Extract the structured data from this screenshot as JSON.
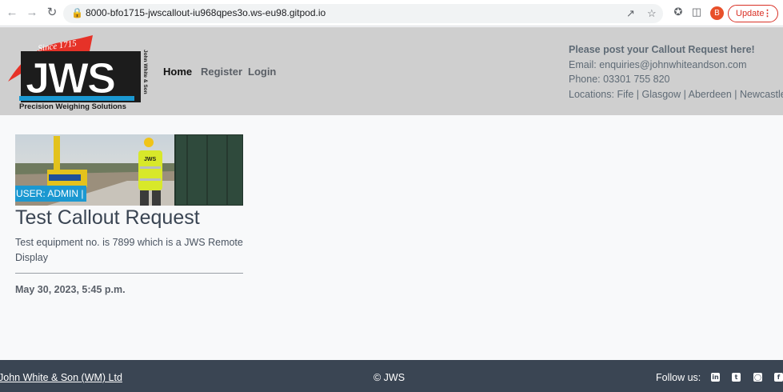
{
  "browser": {
    "url": "8000-bfo1715-jwscallout-iu968qpes3o.ws-eu98.gitpod.io",
    "profile_initial": "B",
    "update_label": "Update",
    "icons": [
      "back-arrow-icon",
      "forward-arrow-icon",
      "reload-icon",
      "lock-icon",
      "share-icon",
      "star-icon",
      "extensions-icon",
      "side-panel-icon",
      "kebab-menu-icon"
    ]
  },
  "header": {
    "logo": {
      "banner": "Since 1715",
      "brand": "JWS",
      "side_text": "John White & Son",
      "tagline": "Precision Weighing Solutions"
    },
    "nav": [
      {
        "label": "Home"
      },
      {
        "label": "Register"
      },
      {
        "label": "Login"
      }
    ],
    "contact": {
      "cta": "Please post your Callout Request here!",
      "email": "Email: enquiries@johnwhiteandson.com",
      "phone": "Phone: 03301 755 820",
      "locations": "Locations: Fife | Glasgow | Aberdeen | Newcastle"
    }
  },
  "card": {
    "badge": "USER: ADMIN |",
    "image_vest_text": "JWS",
    "title": "Test Callout Request",
    "description": "Test equipment no. is 7899 which is a JWS Remote Display",
    "date": "May 30, 2023, 5:45 p.m."
  },
  "footer": {
    "company": "John White & Son (WM) Ltd",
    "copyright": "© JWS",
    "follow": "Follow us:",
    "social_icons": [
      "linkedin-icon",
      "twitter-icon",
      "instagram-icon",
      "facebook-icon"
    ]
  },
  "colors": {
    "header_bg": "#cfcfcf",
    "footer_bg": "#3a4553",
    "badge_bg": "#1b98d1",
    "update_red": "#d93025",
    "logo_red": "#e63228"
  }
}
